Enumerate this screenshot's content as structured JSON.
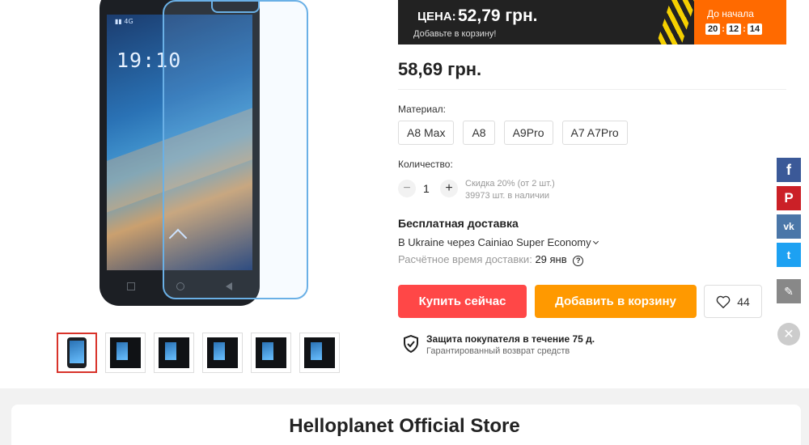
{
  "promo": {
    "price_label": "ЦЕНА:",
    "price": "52,79 грн.",
    "subtitle": "Добавьте в корзину!",
    "timer_label": "До начала",
    "timer": [
      "20",
      "12",
      "14"
    ],
    "accent_color": "#ff6a00",
    "stripe_color": "#f5d000"
  },
  "product": {
    "price": "58,69 грн.",
    "material_label": "Материал:",
    "materials": [
      "A8 Max",
      "A8",
      "A9Pro",
      "A7 A7Pro"
    ],
    "quantity_label": "Количество:",
    "quantity": "1",
    "minus": "−",
    "plus": "+",
    "discount": "Скидка 20% (от 2 шт.)",
    "stock": "39973 шт. в наличии",
    "phone_screen": {
      "status": "▮▮ 4G",
      "clock": "19:10"
    }
  },
  "shipping": {
    "title": "Бесплатная доставка",
    "method": "В Ukraine через Cainiao Super Economy",
    "time_label": "Расчётное время доставки:",
    "date": "29 янв",
    "help_icon": "?"
  },
  "actions": {
    "buy": "Купить сейчас",
    "cart": "Добавить в корзину",
    "wishlist_count": "44",
    "buy_color": "#ff4747",
    "cart_color": "#ff9900"
  },
  "protection": {
    "title": "Защита покупателя в течение 75 д.",
    "subtitle": "Гарантированный возврат средств"
  },
  "share": {
    "facebook": "f",
    "pinterest": "P",
    "vk": "vk",
    "twitter": "t",
    "edit": "✎",
    "close": "✕"
  },
  "store": {
    "name": "Helloplanet Official Store"
  },
  "gallery": {
    "thumbnail_count": 6,
    "active_index": 0
  }
}
